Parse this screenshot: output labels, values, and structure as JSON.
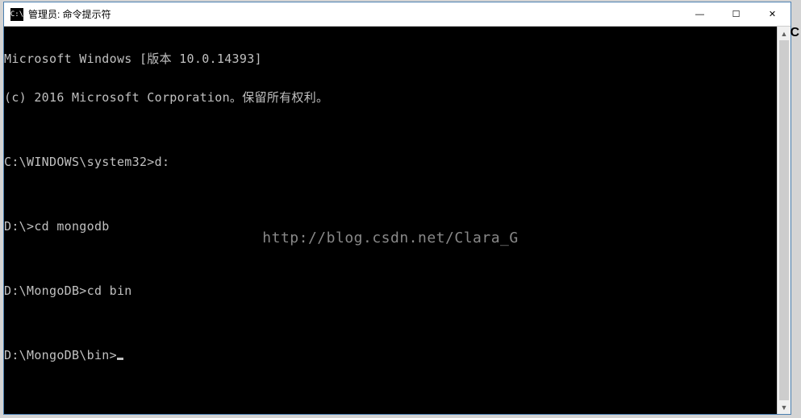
{
  "titlebar": {
    "icon_text": "C:\\",
    "title": "管理员: 命令提示符",
    "minimize": "—",
    "maximize": "☐",
    "close": "✕"
  },
  "terminal": {
    "lines": [
      "Microsoft Windows [版本 10.0.14393]",
      "(c) 2016 Microsoft Corporation。保留所有权利。",
      "",
      "C:\\WINDOWS\\system32>d:",
      "",
      "D:\\>cd mongodb",
      "",
      "D:\\MongoDB>cd bin",
      "",
      "D:\\MongoDB\\bin>"
    ]
  },
  "watermark": "http://blog.csdn.net/Clara_G",
  "scrollbar": {
    "up": "▲",
    "down": "▼"
  },
  "outside": "C"
}
